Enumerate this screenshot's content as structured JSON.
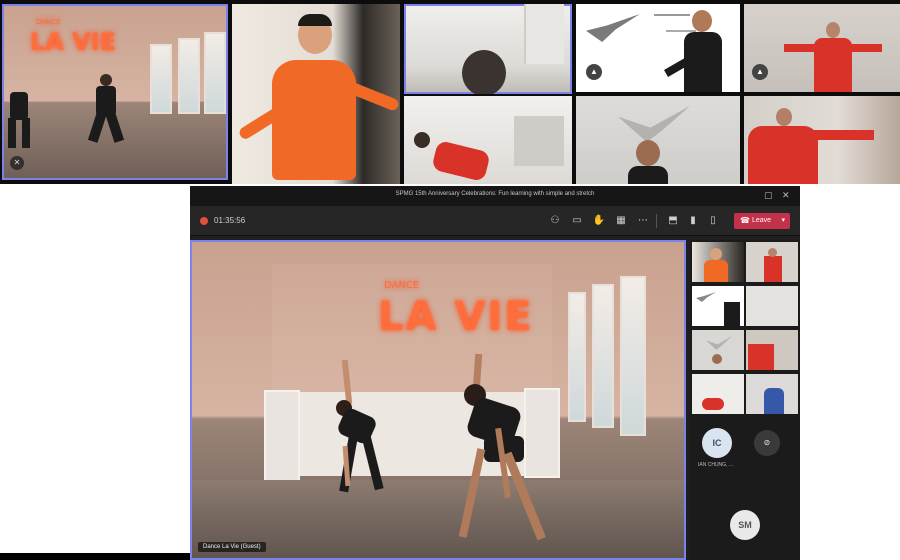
{
  "meeting": {
    "title": "SPMG 15th Anniversary Celebrations: Fun learning with simple and stretch",
    "timer": "01:35:56",
    "leave_label": "Leave",
    "spotlight_name": "Dance La Vie (Guest)"
  },
  "studio_sign": {
    "small": "DANCE",
    "large": "LA VIE"
  },
  "participants": [
    {
      "initials": "IC",
      "name": "IAN CHUNG, ..."
    },
    {
      "initials": "SM",
      "name": ""
    }
  ],
  "colors": {
    "accent": "#7b83eb",
    "leave": "#c4314b",
    "orange_shirt": "#f06a25",
    "red_shirt": "#d93228"
  },
  "icons": [
    "record-icon",
    "people-icon",
    "chat-icon",
    "reactions-icon",
    "view-icon",
    "more-icon",
    "share-icon",
    "camera-icon",
    "mic-icon",
    "phone-icon",
    "chevron-down-icon"
  ]
}
